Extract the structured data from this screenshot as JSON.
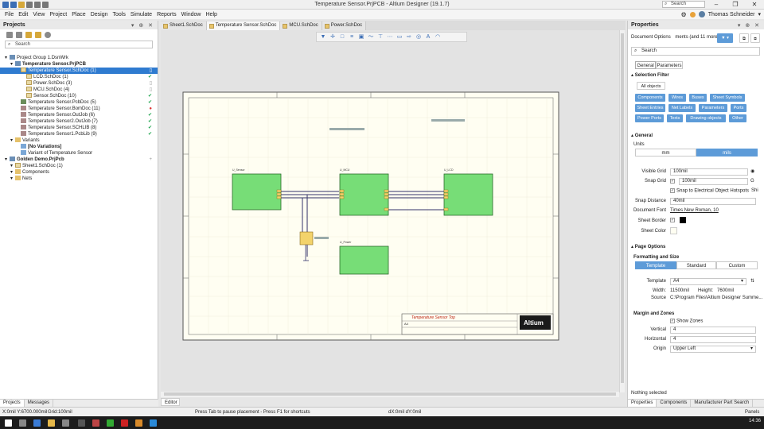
{
  "window": {
    "title": "Temperature Sensor.PrjPCB - Altium Designer (19.1.7)",
    "search_label": "Search",
    "controls": [
      "–",
      "❐",
      "✕"
    ]
  },
  "menu": {
    "items": [
      "File",
      "Edit",
      "View",
      "Project",
      "Place",
      "Design",
      "Tools",
      "Simulate",
      "Reports",
      "Window",
      "Help"
    ],
    "user": "Thomas Schneider"
  },
  "projects_panel": {
    "title": "Projects",
    "search_placeholder": "Search",
    "tree": [
      {
        "label": "Project Group 1.DsnWrk",
        "indent": 0,
        "icon": "project-group",
        "status": ""
      },
      {
        "label": "Temperature Sensor.PrjPCB",
        "indent": 1,
        "icon": "project",
        "status": "",
        "bold": true
      },
      {
        "label": "Temperature Sensor.SchDoc (1)",
        "indent": 2,
        "icon": "schematic",
        "status": "doc",
        "selected": true
      },
      {
        "label": "LCD.SchDoc (1)",
        "indent": 3,
        "icon": "schematic",
        "status": "ok"
      },
      {
        "label": "Power.SchDoc (3)",
        "indent": 3,
        "icon": "schematic",
        "status": "doc"
      },
      {
        "label": "MCU.SchDoc (4)",
        "indent": 3,
        "icon": "schematic",
        "status": "doc"
      },
      {
        "label": "Sensor.SchDoc (10)",
        "indent": 3,
        "icon": "schematic",
        "status": "ok"
      },
      {
        "label": "Temperature Sensor.PcbDoc (5)",
        "indent": 2,
        "icon": "pcb",
        "status": "ok"
      },
      {
        "label": "Temperature Sensor.BomDoc (11)",
        "indent": 2,
        "icon": "other",
        "status": "err"
      },
      {
        "label": "Temperature Sensor.OutJob (6)",
        "indent": 2,
        "icon": "other",
        "status": "ok"
      },
      {
        "label": "Temperature Sensor2.OutJob (7)",
        "indent": 2,
        "icon": "other",
        "status": "ok"
      },
      {
        "label": "Temperature Sensor.SCHLIB (8)",
        "indent": 2,
        "icon": "other",
        "status": "ok"
      },
      {
        "label": "Temperature Sensor1.PcbLib (9)",
        "indent": 2,
        "icon": "other",
        "status": "ok"
      },
      {
        "label": "Variants",
        "indent": 1,
        "icon": "folder",
        "status": ""
      },
      {
        "label": "[No Variations]",
        "indent": 2,
        "icon": "variant",
        "status": "",
        "bold": true
      },
      {
        "label": "Variant of Temperature Sensor",
        "indent": 2,
        "icon": "variant",
        "status": ""
      },
      {
        "label": "Golden Demo.PrjPcb",
        "indent": 0,
        "icon": "project",
        "status": "add",
        "bold": true
      },
      {
        "label": "Sheet1.SchDoc (1)",
        "indent": 1,
        "icon": "schematic",
        "status": ""
      },
      {
        "label": "Components",
        "indent": 1,
        "icon": "folder",
        "status": ""
      },
      {
        "label": "Nets",
        "indent": 1,
        "icon": "folder",
        "status": ""
      }
    ],
    "bottom_tabs": [
      "Projects",
      "Messages"
    ]
  },
  "doc_tabs": [
    "Sheet1.SchDoc",
    "Temperature Sensor.SchDoc",
    "MCU.SchDoc",
    "Power.SchDoc"
  ],
  "editor_tab": "Editor",
  "schematic": {
    "title_text": "Temperature Sensor Top",
    "size": "A4",
    "logo": "Altium",
    "blocks": [
      "U_Sensor",
      "U_MCU",
      "U_LCD",
      "U_Power"
    ]
  },
  "properties": {
    "title": "Properties",
    "doc_options": "Document Options",
    "doc_options_extra": "ments (and 11 more)",
    "search_placeholder": "Search",
    "tabs": [
      "General",
      "Parameters"
    ],
    "selection_filter": "Selection Filter",
    "all_objects": "All objects",
    "filters": [
      "Components",
      "Wires",
      "Buses",
      "Sheet Symbols",
      "Sheet Entries",
      "Net Labels",
      "Parameters",
      "Ports",
      "Power Ports",
      "Texts",
      "Drawing objects",
      "Other"
    ],
    "general": "General",
    "units_label": "Units",
    "units": [
      "mm",
      "mils"
    ],
    "visible_grid_label": "Visible Grid",
    "visible_grid": "100mil",
    "snap_grid_label": "Snap Grid",
    "snap_grid": "100mil",
    "snap_grid_key": "G",
    "snap_hotspots": "Snap to Electrical Object Hotspots",
    "snap_hotspots_key": "Shi",
    "snap_distance_label": "Snap Distance",
    "snap_distance": "40mil",
    "doc_font_label": "Document Font",
    "doc_font": "Times New Roman, 10",
    "sheet_border_label": "Sheet Border",
    "sheet_color_label": "Sheet Color",
    "page_options": "Page Options",
    "formatting": "Formatting and Size",
    "format_modes": [
      "Template",
      "Standard",
      "Custom"
    ],
    "template_label": "Template",
    "template": "A4",
    "width_label": "Width:",
    "width": "11500mil",
    "height_label": "Height:",
    "height": "7600mil",
    "source_label": "Source",
    "source": "C:\\Program Files\\Altium Designer Summe...",
    "margin_zones": "Margin and Zones",
    "show_zones": "Show Zones",
    "vertical_label": "Vertical",
    "vertical": "4",
    "horizontal_label": "Horizontal",
    "horizontal": "4",
    "origin_label": "Origin",
    "origin": "Upper Left",
    "nothing_selected": "Nothing selected",
    "bottom_tabs": [
      "Properties",
      "Components",
      "Manufacturer Part Search"
    ]
  },
  "status": {
    "coords": "X:0mil Y:6700.000mil",
    "grid": "Grid:100mil",
    "hint": "Press Tab to pause placement - Press F1 for shortcuts",
    "delta": "dX:0mil dY:0mil",
    "panels": "Panels"
  },
  "taskbar": {
    "time": "14:36"
  },
  "colors": {
    "accent": "#5d9bd8",
    "sheet_block": "#77dd77",
    "selection": "#2f7bd0"
  }
}
